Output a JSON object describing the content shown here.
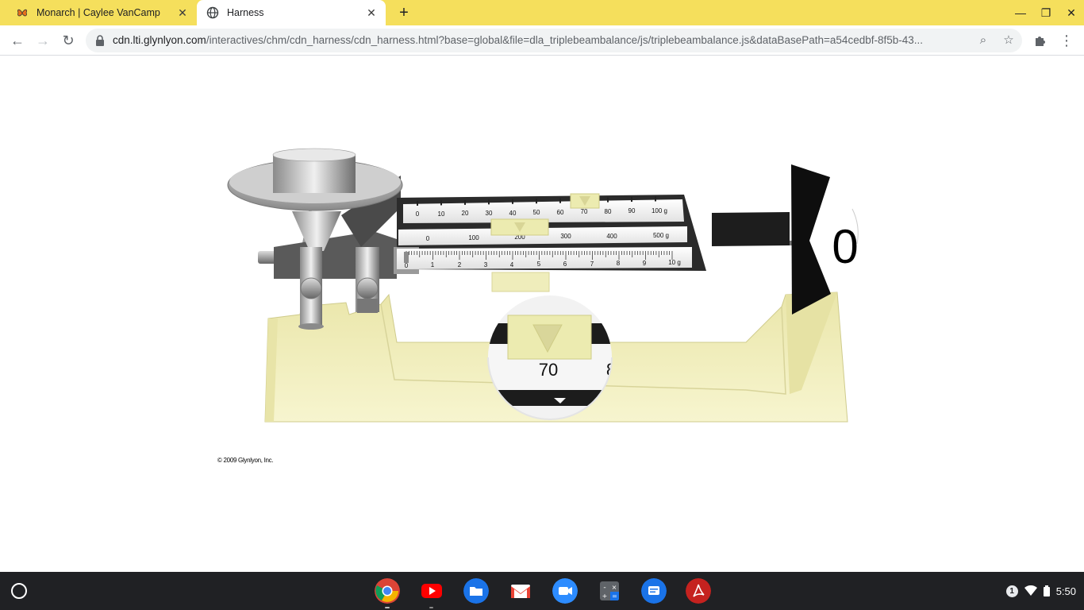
{
  "tabs": [
    {
      "title": "Monarch | Caylee VanCamp",
      "active": false,
      "icon": "monarch-logo-icon"
    },
    {
      "title": "Harness",
      "active": true,
      "icon": "globe-icon"
    }
  ],
  "toolbar": {
    "url_host": "cdn.lti.glynlyon.com",
    "url_path": "/interactives/chm/cdn_harness/cdn_harness.html?base=global&file=dla_triplebeambalance/js/triplebeambalance.js&dataBasePath=a54cedbf-8f5b-43..."
  },
  "balance": {
    "beam_100": {
      "labels": [
        "0",
        "10",
        "20",
        "30",
        "40",
        "50",
        "60",
        "70",
        "80",
        "90",
        "100 g"
      ],
      "rider_value": 70
    },
    "beam_500": {
      "labels": [
        "0",
        "100",
        "200",
        "300",
        "400",
        "500 g"
      ],
      "rider_value": 200
    },
    "beam_10": {
      "labels": [
        "0",
        "1",
        "2",
        "3",
        "4",
        "5",
        "6",
        "7",
        "8",
        "9",
        "10 g"
      ],
      "rider_value": 0
    },
    "pointer_label": "0",
    "magnifier": {
      "label": "70",
      "partial_label": "8"
    },
    "colors": {
      "base": "#f4f1be",
      "rider": "#ecebb0",
      "beam": "#2a2a2a"
    }
  },
  "copyright": "© 2009 Glynlyon, Inc.",
  "shelf": {
    "apps": [
      "chrome-icon",
      "youtube-icon",
      "files-icon",
      "gmail-icon",
      "zoom-icon",
      "calculator-icon",
      "messages-icon",
      "acrobat-icon"
    ],
    "notification_count": "1",
    "time": "5:50"
  }
}
